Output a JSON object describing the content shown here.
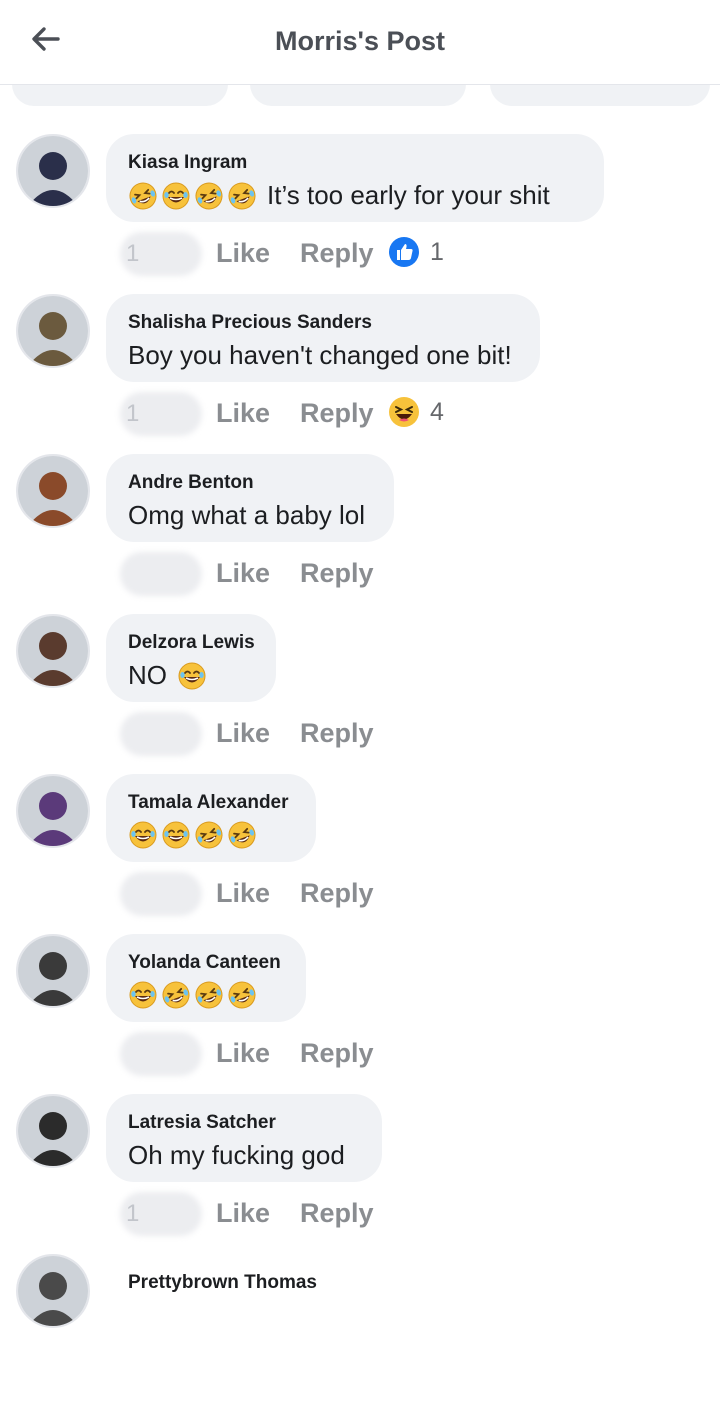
{
  "header": {
    "title": "Morris's Post"
  },
  "comments": [
    {
      "author": "Kiasa Ingram",
      "emojis": [
        "rofl",
        "joy",
        "rofl",
        "rofl"
      ],
      "text": "It’s too early for your shit",
      "time": "1",
      "like_label": "Like",
      "reply_label": "Reply",
      "reaction": {
        "icon": "like-reaction-icon",
        "count": "1"
      },
      "avatar_color": "#2a2f4a"
    },
    {
      "author": "Shalisha Precious Sanders",
      "emojis": [],
      "text": "Boy you haven't changed one bit!",
      "time": "1",
      "like_label": "Like",
      "reply_label": "Reply",
      "reaction": {
        "icon": "haha-reaction-icon",
        "count": "4"
      },
      "avatar_color": "#6b5a3e"
    },
    {
      "author": "Andre Benton",
      "emojis": [],
      "text": "Omg what a baby lol",
      "time": "",
      "like_label": "Like",
      "reply_label": "Reply",
      "reaction": null,
      "avatar_color": "#8a4a2a"
    },
    {
      "author": "Delzora Lewis",
      "emojis_after": [
        "joy"
      ],
      "emojis": [],
      "text": "NO",
      "time": "",
      "like_label": "Like",
      "reply_label": "Reply",
      "reaction": null,
      "avatar_color": "#5a3b2e"
    },
    {
      "author": "Tamala Alexander",
      "emojis": [
        "joy",
        "joy",
        "rofl",
        "rofl"
      ],
      "text": "",
      "time": "",
      "like_label": "Like",
      "reply_label": "Reply",
      "reaction": null,
      "avatar_color": "#5b3a7a"
    },
    {
      "author": "Yolanda Canteen",
      "emojis": [
        "joy",
        "rofl",
        "rofl",
        "rofl"
      ],
      "text": "",
      "time": "",
      "like_label": "Like",
      "reply_label": "Reply",
      "reaction": null,
      "avatar_color": "#3a3a3a"
    },
    {
      "author": "Latresia Satcher",
      "emojis": [],
      "text": "Oh my fucking god",
      "time": "1",
      "like_label": "Like",
      "reply_label": "Reply",
      "reaction": null,
      "avatar_color": "#2b2b2b"
    },
    {
      "author": "Prettybrown Thomas",
      "emojis": [],
      "text": "",
      "time": "",
      "like_label": "",
      "reply_label": "",
      "reaction": null,
      "avatar_color": "#4a4a4a"
    }
  ],
  "colors": {
    "bubble": "#f0f2f5",
    "action_gray": "#8a8d91",
    "like_blue": "#1877f2",
    "emoji_yellow": "#f7c23b"
  }
}
